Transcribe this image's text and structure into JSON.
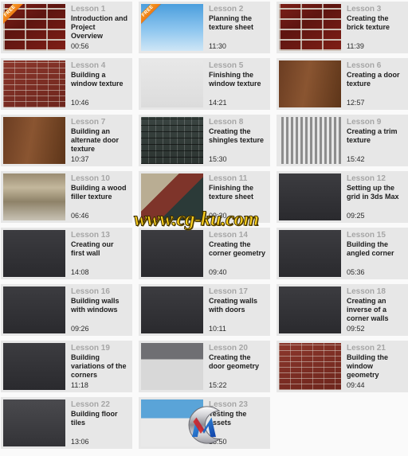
{
  "page": {
    "background_color": "#fafafa",
    "card_background_color": "#e7e7e7",
    "lesson_number_color": "#a6a6a6",
    "title_color": "#1d1d1d",
    "free_badge_color": "#ee7a14",
    "columns": 3
  },
  "watermarks": {
    "text": "www.cg-ku.com",
    "text_color": "#ffd21e",
    "logo_label": "CM"
  },
  "lessons": [
    {
      "number": "Lesson 1",
      "title": "Introduction and Project Overview",
      "duration": "00:56",
      "free": true,
      "badge_label": "FREE",
      "thumb": "t-brick-dark"
    },
    {
      "number": "Lesson 2",
      "title": "Planning the texture sheet",
      "duration": "11:30",
      "free": true,
      "badge_label": "FREE",
      "thumb": "t-sky"
    },
    {
      "number": "Lesson 3",
      "title": "Creating the brick texture",
      "duration": "11:39",
      "free": false,
      "badge_label": "",
      "thumb": "t-brick-dark"
    },
    {
      "number": "Lesson 4",
      "title": "Building a window texture",
      "duration": "10:46",
      "free": false,
      "badge_label": "",
      "thumb": "t-brick-red"
    },
    {
      "number": "Lesson 5",
      "title": "Finishing the window texture",
      "duration": "14:21",
      "free": false,
      "badge_label": "",
      "thumb": "t-window-tex"
    },
    {
      "number": "Lesson 6",
      "title": "Creating a door texture",
      "duration": "12:57",
      "free": false,
      "badge_label": "",
      "thumb": "t-door"
    },
    {
      "number": "Lesson 7",
      "title": "Building an alternate door texture",
      "duration": "10:37",
      "free": false,
      "badge_label": "",
      "thumb": "t-door"
    },
    {
      "number": "Lesson 8",
      "title": "Creating the shingles texture",
      "duration": "15:30",
      "free": false,
      "badge_label": "",
      "thumb": "t-shingle"
    },
    {
      "number": "Lesson 9",
      "title": "Creating a trim texture",
      "duration": "15:42",
      "free": false,
      "badge_label": "",
      "thumb": "t-trim"
    },
    {
      "number": "Lesson 10",
      "title": "Building a wood filler texture",
      "duration": "06:46",
      "free": false,
      "badge_label": "",
      "thumb": "t-wood"
    },
    {
      "number": "Lesson 11",
      "title": "Finishing the texture sheet",
      "duration": "09:30",
      "free": false,
      "badge_label": "",
      "thumb": "t-sheet"
    },
    {
      "number": "Lesson 12",
      "title": "Setting up the grid in 3ds Max",
      "duration": "09:25",
      "free": false,
      "badge_label": "",
      "thumb": "t-dark3d"
    },
    {
      "number": "Lesson 13",
      "title": "Creating our first wall",
      "duration": "14:08",
      "free": false,
      "badge_label": "",
      "thumb": "t-dark3d"
    },
    {
      "number": "Lesson 14",
      "title": "Creating the corner geometry",
      "duration": "09:40",
      "free": false,
      "badge_label": "",
      "thumb": "t-dark3d"
    },
    {
      "number": "Lesson 15",
      "title": "Building the angled corner",
      "duration": "05:36",
      "free": false,
      "badge_label": "",
      "thumb": "t-dark3d"
    },
    {
      "number": "Lesson 16",
      "title": "Building walls with windows",
      "duration": "09:26",
      "free": false,
      "badge_label": "",
      "thumb": "t-dark3d"
    },
    {
      "number": "Lesson 17",
      "title": "Creating walls with doors",
      "duration": "10:11",
      "free": false,
      "badge_label": "",
      "thumb": "t-dark3d"
    },
    {
      "number": "Lesson 18",
      "title": "Creating an inverse of a corner walls",
      "duration": "09:52",
      "free": false,
      "badge_label": "",
      "thumb": "t-dark3d"
    },
    {
      "number": "Lesson 19",
      "title": "Building variations of the corners",
      "duration": "11:18",
      "free": false,
      "badge_label": "",
      "thumb": "t-dark3d"
    },
    {
      "number": "Lesson 20",
      "title": "Creating the door geometry",
      "duration": "15:22",
      "free": false,
      "badge_label": "",
      "thumb": "t-whitebox"
    },
    {
      "number": "Lesson 21",
      "title": "Building the window geometry",
      "duration": "09:44",
      "free": false,
      "badge_label": "",
      "thumb": "t-brick-red"
    },
    {
      "number": "Lesson 22",
      "title": "Building floor tiles",
      "duration": "13:06",
      "free": false,
      "badge_label": "",
      "thumb": "t-floor"
    },
    {
      "number": "Lesson 23",
      "title": "Testing the assets",
      "duration": "13:50",
      "free": false,
      "badge_label": "",
      "thumb": "t-red-building"
    }
  ]
}
